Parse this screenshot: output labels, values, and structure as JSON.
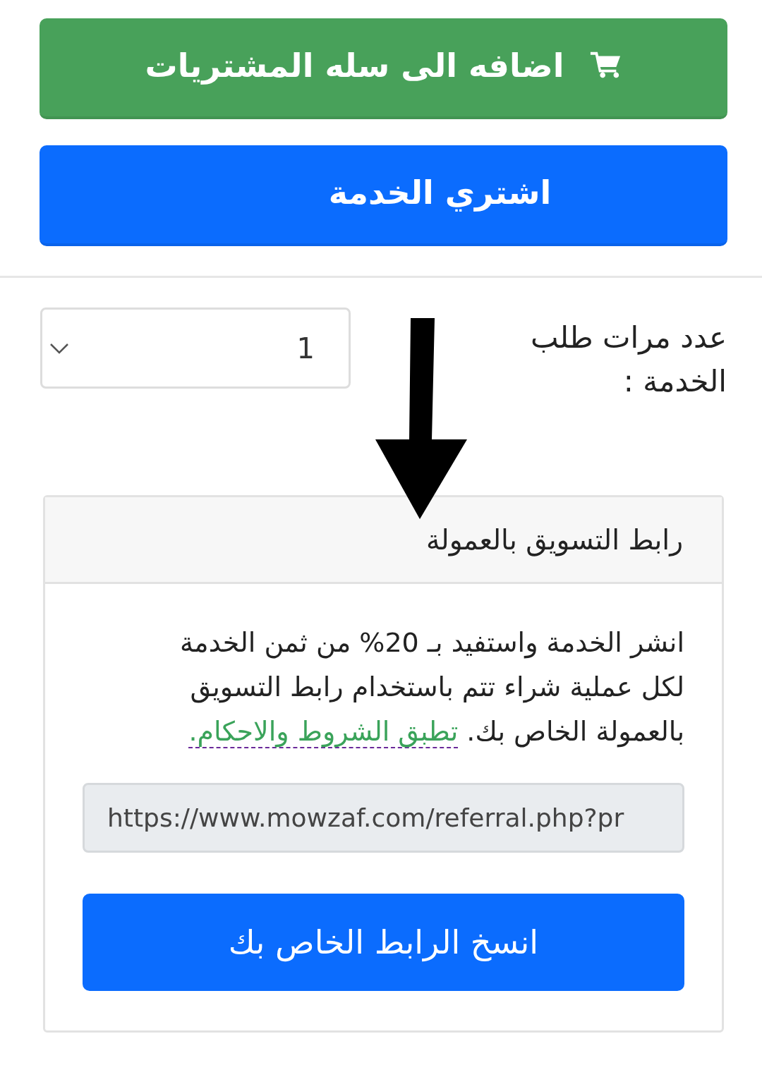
{
  "buttons": [
    {
      "kind": "add_to_cart",
      "label": "اضافه الى سله المشتريات",
      "color": "#48a15a"
    },
    {
      "kind": "buy",
      "label": "اشتري الخدمة",
      "color": "#0b6cfe"
    }
  ],
  "quantity": {
    "label": "عدد مرات طلب الخدمة :",
    "value": "1"
  },
  "affiliate_card": {
    "title": "رابط التسويق بالعمولة",
    "description": "انشر الخدمة واستفيد بـ 20% من ثمن الخدمة لكل عملية شراء تتم باستخدام رابط التسويق بالعمولة الخاص بك.",
    "terms_link": "تطبق الشروط والاحكام.",
    "link_field": "https://www.mowzaf.com/referral.php?pr",
    "copy_button": "انسخ الرابط الخاص بك"
  }
}
